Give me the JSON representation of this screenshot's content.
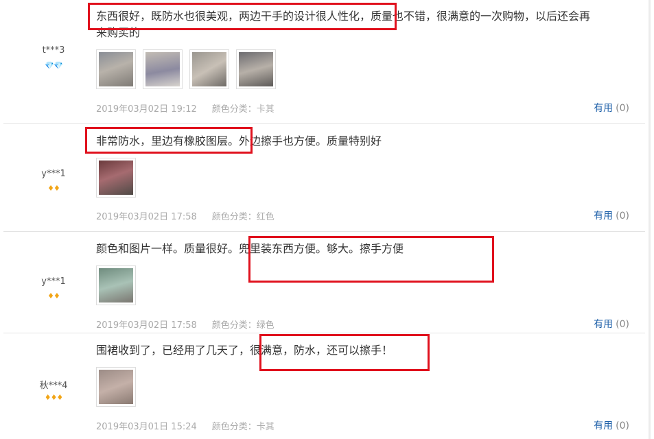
{
  "reviews": [
    {
      "user": "t***3",
      "badge": "💎💎",
      "text_line1": "东西很好，既防水也很美观，两边干手的设计很人性化，质量也不错，很满意的一次购物，以后还会再",
      "text_line2": "来购买的",
      "date": "2019年03月02日 19:12",
      "color_label": "颜色分类：卡其",
      "helpful_label": "有用",
      "helpful_count": "(0)"
    },
    {
      "user": "y***1",
      "badge": "♦♦",
      "text_line1": "非常防水，里边有橡胶图层。外边擦手也方便。质量特别好",
      "date": "2019年03月02日 17:58",
      "color_label": "颜色分类：红色",
      "helpful_label": "有用",
      "helpful_count": "(0)"
    },
    {
      "user": "y***1",
      "badge": "♦♦",
      "text_line1": "颜色和图片一样。质量很好。兜里装东西方便。够大。擦手方便",
      "date": "2019年03月02日 17:58",
      "color_label": "颜色分类：绿色",
      "helpful_label": "有用",
      "helpful_count": "(0)"
    },
    {
      "user": "秋***4",
      "badge": "♦♦♦",
      "text_line1": "围裙收到了，已经用了几天了，很满意，防水，还可以擦手！",
      "date": "2019年03月01日 15:24",
      "color_label": "颜色分类：卡其",
      "helpful_label": "有用",
      "helpful_count": "(0)"
    }
  ],
  "colors": {
    "highlight": "#e0111d",
    "link": "#1d5fa8",
    "meta_text": "#aaaaaa"
  }
}
